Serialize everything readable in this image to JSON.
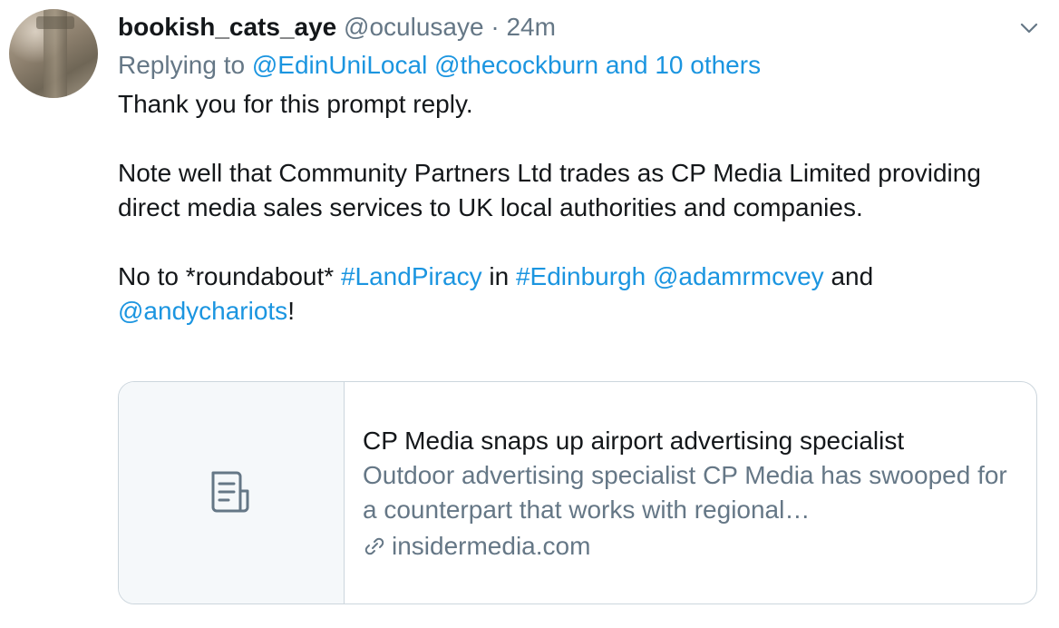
{
  "tweet": {
    "author_name": "bookish_cats_aye",
    "author_handle": "@oculusaye",
    "separator": "·",
    "time": "24m",
    "replying_prefix": "Replying to",
    "replying_user_1": "@EdinUniLocal",
    "replying_user_2": "@thecockburn",
    "replying_others": "and 10 others",
    "para1": "Thank you for this prompt reply.",
    "para2": "Note well that Community Partners Ltd trades as CP Media Limited providing direct media sales services to UK local authorities and companies.",
    "para3_start": "No to *roundabout*",
    "hashtag_1": "#LandPiracy",
    "para3_in": "in",
    "hashtag_2": "#Edinburgh",
    "mention_1": "@adamrmcvey",
    "para3_and": "and",
    "mention_2": "@andychariots",
    "para3_end": "!"
  },
  "card": {
    "title": "CP Media snaps up airport advertising specialist",
    "description": "Outdoor advertising specialist CP Media has swooped for a counterpart that works with regional…",
    "domain": "insidermedia.com",
    "thumb_icon": "document-icon",
    "domain_icon": "link-icon"
  },
  "menu": {
    "icon": "chevron-down-icon"
  },
  "colors": {
    "link": "#1b95e0",
    "secondary": "#657786",
    "text": "#14171a",
    "border": "#ccd6dd"
  }
}
